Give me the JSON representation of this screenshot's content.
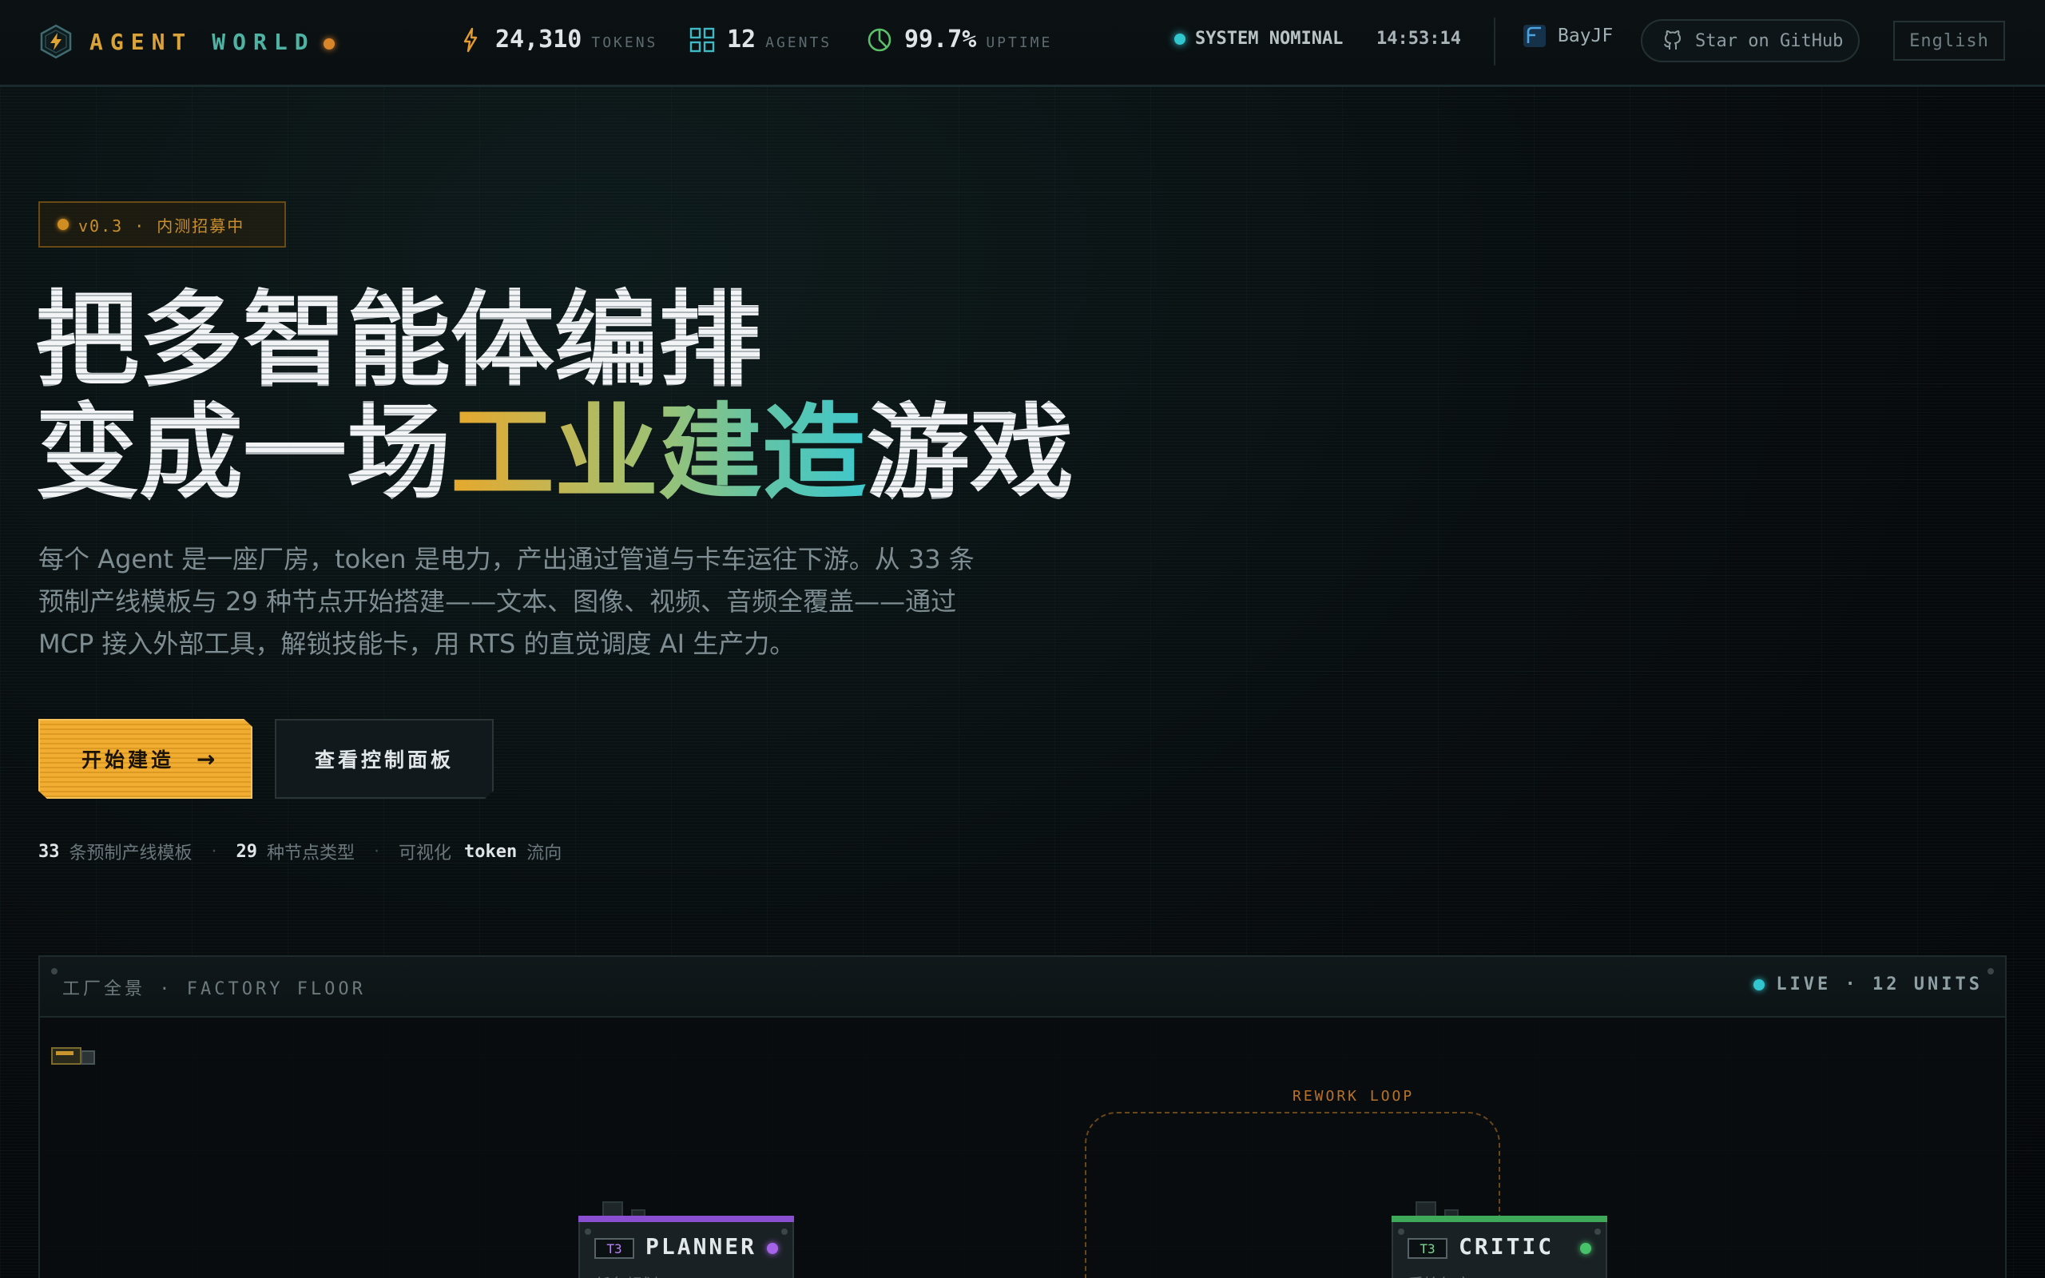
{
  "header": {
    "brand_part1": "AGENT",
    "brand_part2": "WORLD",
    "stats": [
      {
        "icon": "bolt-icon",
        "value": "24,310",
        "unit": "TOKENS",
        "color": "#e39a2e"
      },
      {
        "icon": "grid-icon",
        "value": "12",
        "unit": "AGENTS",
        "color": "#3fb9c4"
      },
      {
        "icon": "gauge-icon",
        "value": "99.7%",
        "unit": "UPTIME",
        "color": "#5bbf6a"
      }
    ],
    "status": "SYSTEM NOMINAL",
    "clock": "14:53:14",
    "user": "BayJF",
    "github_label": "Star on GitHub",
    "language": "English"
  },
  "hero": {
    "badge": "v0.3 · 内测招募中",
    "title_line1": "把多智能体编排",
    "title_line2_pre": "变成一场",
    "title_line2_accent": "工业建造",
    "title_line2_post": "游戏",
    "description": "每个 Agent 是一座厂房，token 是电力，产出通过管道与卡车运往下游。从 33 条预制产线模板与 29 种节点开始搭建——文本、图像、视频、音频全覆盖——通过 MCP 接入外部工具，解锁技能卡，用 RTS 的直觉调度 AI 生产力。",
    "primary_button": "开始建造",
    "primary_arrow": "→",
    "secondary_button": "查看控制面板",
    "facts": [
      {
        "num": "33",
        "text": "条预制产线模板"
      },
      {
        "num": "29",
        "text": "种节点类型"
      },
      {
        "pre": "可视化",
        "num": "token",
        "text": "流向"
      }
    ],
    "fact_separator": "·"
  },
  "factory": {
    "title": "工厂全景 · FACTORY FLOOR",
    "live": "LIVE · 12 UNITS",
    "loop_label": "REWORK LOOP",
    "nodes": [
      {
        "tier": "T3",
        "name": "PLANNER",
        "sub": "任务规划",
        "accent": "#8a4fd1",
        "led": "#a463e8"
      },
      {
        "tier": "T3",
        "name": "CRITIC",
        "sub": "质检复审",
        "accent": "#3fa95a",
        "led": "#48c26a"
      }
    ]
  },
  "colors": {
    "accent_amber": "#f0ad32",
    "accent_teal": "#3ec8cc",
    "background": "#06090b"
  }
}
